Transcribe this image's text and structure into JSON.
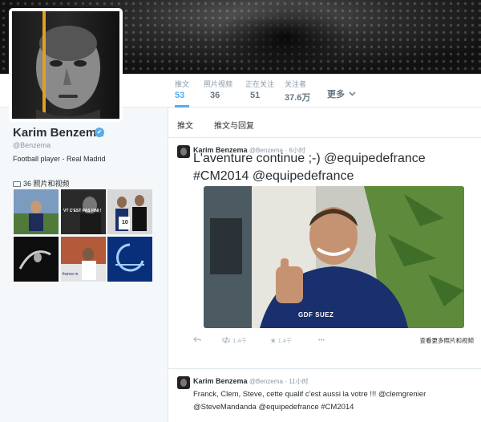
{
  "profile": {
    "name": "Karim Benzema",
    "handle": "@Benzema",
    "bio": "Football player - Real Madrid",
    "verified_glyph": "✔",
    "photos_label": "36 照片和视频"
  },
  "stats": [
    {
      "label": "推文",
      "value": "53",
      "active": true
    },
    {
      "label": "照片视频",
      "value": "36",
      "active": false
    },
    {
      "label": "正在关注",
      "value": "51",
      "active": false
    },
    {
      "label": "关注者",
      "value": "37.6万",
      "active": false
    }
  ],
  "more": {
    "label": "更多",
    "icon": "chevron-down-icon"
  },
  "tabs": [
    "推文",
    "推文与回复"
  ],
  "tweets": [
    {
      "name": "Karim Benzema",
      "handle": "@Benzema",
      "time": "6小时",
      "text": "L'aventure continue ;-) @equipedefrance #CM2014 @equipedefrance",
      "media_text": "GDF SUEZ",
      "retweets": "1.4千",
      "favorites": "1.4千",
      "media_link": "查看更多照片和视频"
    },
    {
      "name": "Karim Benzema",
      "handle": "@Benzema",
      "time": "11小时",
      "text": "Franck, Clem, Steve, cette qualif c'est aussi la votre !!! @clemgrenier @SteveMandanda @equipedefrance #CM2014"
    }
  ],
  "thumbs": [
    {
      "caption": ""
    },
    {
      "caption": "VT C'EST PAS FINI !"
    },
    {
      "caption": "10"
    },
    {
      "caption": ""
    },
    {
      "caption": "france m"
    },
    {
      "caption": ""
    }
  ],
  "colors": {
    "accent": "#55acee",
    "verified": "#55acee",
    "border": "#e1e8ed"
  }
}
